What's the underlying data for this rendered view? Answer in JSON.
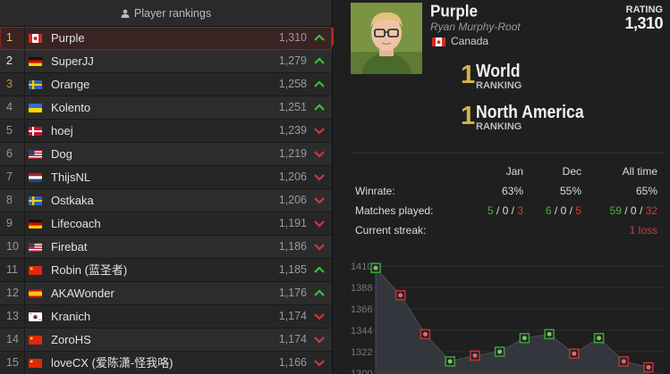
{
  "rankings": {
    "header": "Player rankings",
    "rows": [
      {
        "rank": "1",
        "name": "Purple",
        "rating": "1,310",
        "flag": "ca",
        "trend": "up"
      },
      {
        "rank": "2",
        "name": "SuperJJ",
        "rating": "1,279",
        "flag": "de",
        "trend": "up"
      },
      {
        "rank": "3",
        "name": "Orange",
        "rating": "1,258",
        "flag": "se",
        "trend": "up"
      },
      {
        "rank": "4",
        "name": "Kolento",
        "rating": "1,251",
        "flag": "ua",
        "trend": "up"
      },
      {
        "rank": "5",
        "name": "hoej",
        "rating": "1,239",
        "flag": "dk",
        "trend": "down"
      },
      {
        "rank": "6",
        "name": "Dog",
        "rating": "1,219",
        "flag": "us",
        "trend": "down"
      },
      {
        "rank": "7",
        "name": "ThijsNL",
        "rating": "1,206",
        "flag": "nl",
        "trend": "down"
      },
      {
        "rank": "8",
        "name": "Ostkaka",
        "rating": "1,206",
        "flag": "se",
        "trend": "down"
      },
      {
        "rank": "9",
        "name": "Lifecoach",
        "rating": "1,191",
        "flag": "de",
        "trend": "down"
      },
      {
        "rank": "10",
        "name": "Firebat",
        "rating": "1,186",
        "flag": "us",
        "trend": "down"
      },
      {
        "rank": "11",
        "name": "Robin (蓝圣者)",
        "rating": "1,185",
        "flag": "cn",
        "trend": "up"
      },
      {
        "rank": "12",
        "name": "AKAWonder",
        "rating": "1,176",
        "flag": "es",
        "trend": "up"
      },
      {
        "rank": "13",
        "name": "Kranich",
        "rating": "1,174",
        "flag": "kr",
        "trend": "down"
      },
      {
        "rank": "14",
        "name": "ZoroHS",
        "rating": "1,174",
        "flag": "cn",
        "trend": "down"
      },
      {
        "rank": "15",
        "name": "loveCX (爱陈潇-怪我咯)",
        "rating": "1,166",
        "flag": "cn",
        "trend": "down"
      }
    ]
  },
  "profile": {
    "name": "Purple",
    "real_name": "Ryan Murphy-Root",
    "country": "Canada",
    "rating_label": "RATING",
    "rating_value": "1,310",
    "world_rank": "1",
    "world_label": "World",
    "region_rank": "1",
    "region_label": "North America",
    "ranking_word": "RANKING"
  },
  "stats": {
    "columns": [
      "Jan",
      "Dec",
      "All time"
    ],
    "winrate_label": "Winrate:",
    "winrate": [
      "63%",
      "55%",
      "65%"
    ],
    "matches_label": "Matches played:",
    "matches": [
      {
        "w": "5",
        "d": "0",
        "l": "3"
      },
      {
        "w": "6",
        "d": "0",
        "l": "5"
      },
      {
        "w": "59",
        "d": "0",
        "l": "32"
      }
    ],
    "sep": "/",
    "streak_label": "Current streak:",
    "streak": "1 loss"
  },
  "chart_data": {
    "type": "area",
    "yticks": [
      "1410",
      "1388",
      "1366",
      "1344",
      "1322",
      "1300"
    ],
    "ylim": [
      1300,
      1410
    ],
    "x": [
      0,
      1,
      2,
      3,
      4,
      5,
      6,
      7,
      8,
      9,
      10,
      11
    ],
    "values": [
      1408,
      1380,
      1340,
      1312,
      1318,
      1322,
      1336,
      1340,
      1320,
      1336,
      1312,
      1306
    ],
    "markers": [
      "win",
      "loss",
      "loss",
      "win",
      "loss",
      "win",
      "win",
      "win",
      "loss",
      "win",
      "loss",
      "loss"
    ],
    "colors": {
      "area": "#33373d",
      "line": "#4a4e55",
      "win": "#3da33a",
      "loss": "#c73131"
    }
  },
  "colors": {
    "accent": "#b62a2a",
    "gold": "#d4b445",
    "up": "#3bbf3b",
    "down": "#cc3a3a"
  }
}
